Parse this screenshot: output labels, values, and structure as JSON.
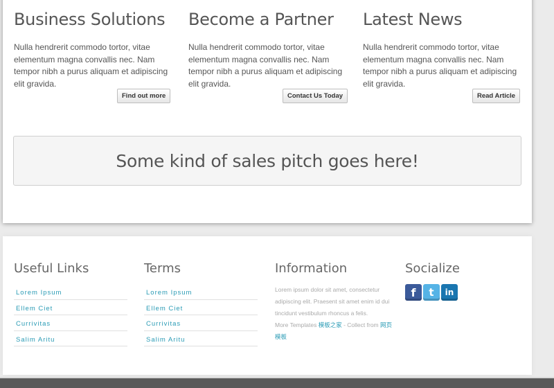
{
  "columns": [
    {
      "title": "Business Solutions",
      "text": "Nulla hendrerit commodo tortor, vitae elementum magna convallis nec. Nam tempor nibh a purus aliquam et adipiscing elit gravida.",
      "button": "Find out more"
    },
    {
      "title": "Become a Partner",
      "text": "Nulla hendrerit commodo tortor, vitae elementum magna convallis nec. Nam tempor nibh a purus aliquam et adipiscing elit gravida.",
      "button": "Contact Us Today"
    },
    {
      "title": "Latest News",
      "text": "Nulla hendrerit commodo tortor, vitae elementum magna convallis nec. Nam tempor nibh a purus aliquam et adipiscing elit gravida.",
      "button": "Read Article"
    }
  ],
  "pitch": "Some kind of sales pitch goes here!",
  "footer": {
    "useful_links": {
      "title": "Useful Links",
      "items": [
        "Lorem Ipsum",
        "Ellem Ciet",
        "Currivitas",
        "Salim Aritu"
      ]
    },
    "terms": {
      "title": "Terms",
      "items": [
        "Lorem Ipsum",
        "Ellem Ciet",
        "Currivitas",
        "Salim Aritu"
      ]
    },
    "information": {
      "title": "Information",
      "text": "Lorem ipsum dolor sit amet, consectetur adipiscing elit. Praesent sit amet enim id dui tincidunt vestibulum rhoncus a felis.",
      "more_prefix": "More Templates",
      "more_link1": "模板之家",
      "collect_prefix": "- Collect from",
      "more_link2": "网页模板"
    },
    "socialize": {
      "title": "Socialize",
      "icons": [
        "facebook-icon",
        "twitter-icon",
        "linkedin-icon"
      ]
    }
  },
  "colors": {
    "link": "#2a9bb5",
    "facebook": "#3b5a9a",
    "twitter": "#55b3e6",
    "linkedin": "#1a76b0"
  }
}
